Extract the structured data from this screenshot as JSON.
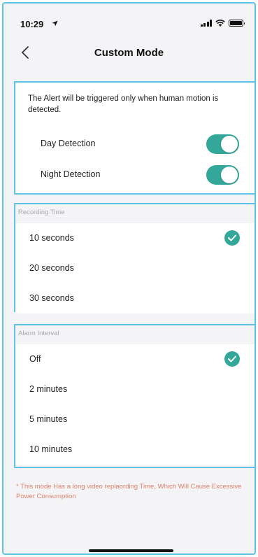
{
  "status_bar": {
    "time": "10:29"
  },
  "header": {
    "title": "Custom Mode"
  },
  "detection": {
    "description": "The Alert will be triggered only when human motion is detected.",
    "toggles": [
      {
        "label": "Day Detection",
        "on": true
      },
      {
        "label": "Night Detection",
        "on": true
      }
    ]
  },
  "recording_time": {
    "heading": "Recording Time",
    "options": [
      "10 seconds",
      "20 seconds",
      "30 seconds"
    ],
    "selected": "10 seconds"
  },
  "alarm_interval": {
    "heading": "Alarm Interval",
    "options": [
      "Off",
      "2 minutes",
      "5 minutes",
      "10 minutes"
    ],
    "selected": "Off"
  },
  "warning": "* This mode Has a long video replaording Time, Which Will Cause Excessive Power Consumption",
  "colors": {
    "accent": "#33a79a",
    "highlight_border": "#5cc3e6",
    "warning": "#e0826e"
  }
}
